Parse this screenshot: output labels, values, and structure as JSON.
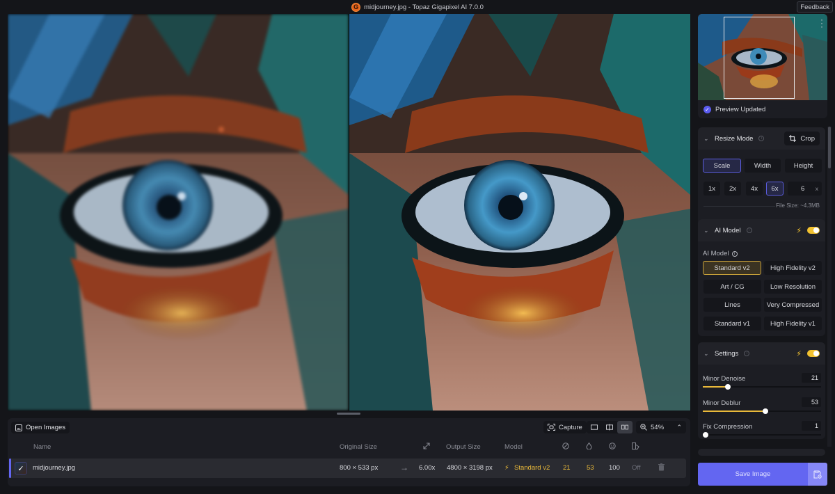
{
  "window": {
    "title": "midjourney.jpg - Topaz Gigapixel AI 7.0.0",
    "app_logo": "G",
    "feedback_label": "Feedback"
  },
  "preview": {
    "status_text": "Preview Updated",
    "status_icon": "check-circle-icon",
    "menu_icon": "kebab-icon"
  },
  "resize_mode": {
    "title": "Resize Mode",
    "crop_label": "Crop",
    "modes": [
      {
        "label": "Scale",
        "selected": true
      },
      {
        "label": "Width",
        "selected": false
      },
      {
        "label": "Height",
        "selected": false
      }
    ],
    "scales": [
      {
        "label": "1x",
        "selected": false
      },
      {
        "label": "2x",
        "selected": false
      },
      {
        "label": "4x",
        "selected": false
      },
      {
        "label": "6x",
        "selected": true
      }
    ],
    "custom_scale_value": "6",
    "custom_scale_suffix": "x",
    "file_size": "File Size: ~4.3MB"
  },
  "ai_model": {
    "title": "AI Model",
    "enabled": true,
    "sub_label": "AI Model",
    "models": [
      {
        "label": "Standard v2",
        "selected": true
      },
      {
        "label": "High Fidelity v2",
        "selected": false
      },
      {
        "label": "Art / CG",
        "selected": false
      },
      {
        "label": "Low Resolution",
        "selected": false
      },
      {
        "label": "Lines",
        "selected": false
      },
      {
        "label": "Very Compressed",
        "selected": false
      },
      {
        "label": "Standard v1",
        "selected": false
      },
      {
        "label": "High Fidelity v1",
        "selected": false
      }
    ]
  },
  "settings": {
    "title": "Settings",
    "enabled": true,
    "sliders": [
      {
        "label": "Minor Denoise",
        "value": "21",
        "fraction": 0.21
      },
      {
        "label": "Minor Deblur",
        "value": "53",
        "fraction": 0.53
      },
      {
        "label": "Fix Compression",
        "value": "1",
        "fraction": 0.01
      }
    ]
  },
  "save": {
    "label": "Save Image",
    "options_icon": "save-settings-icon"
  },
  "queue": {
    "open_images_label": "Open Images",
    "capture_label": "Capture",
    "zoom_level": "54%",
    "view_modes": [
      "single-view",
      "split-view",
      "side-by-side"
    ],
    "active_view": "side-by-side",
    "columns": {
      "name": "Name",
      "original_size": "Original Size",
      "output_size": "Output Size",
      "model": "Model"
    },
    "rows": [
      {
        "checked": true,
        "name": "midjourney.jpg",
        "original_size": "800 × 533 px",
        "scale": "6.00x",
        "output_size": "4800 × 3198 px",
        "model": "Standard v2",
        "denoise": "21",
        "deblur": "53",
        "face": "100",
        "compression": "Off"
      }
    ]
  }
}
